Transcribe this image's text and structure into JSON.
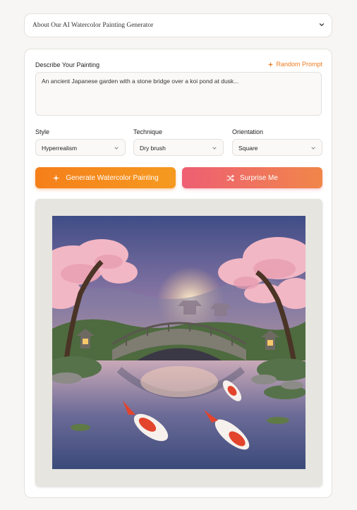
{
  "about": {
    "title": "About Our AI Watercolor Painting Generator",
    "icon": "chevron-down-icon"
  },
  "describe": {
    "label": "Describe Your Painting",
    "random_prompt": "Random Prompt",
    "random_icon": "shuffle-sparkle-icon",
    "placeholder": "An ancient Japanese garden with a stone bridge over a koi pond at dusk..."
  },
  "options": {
    "style": {
      "label": "Style",
      "value": "Hyperrealism"
    },
    "technique": {
      "label": "Technique",
      "value": "Dry brush"
    },
    "orientation": {
      "label": "Orientation",
      "value": "Square"
    }
  },
  "actions": {
    "generate": "Generate Watercolor Painting",
    "generate_icon": "sparkle-icon",
    "surprise": "Surprise Me",
    "surprise_icon": "shuffle-icon"
  },
  "colors": {
    "accent_orange": "#f57f1a",
    "accent_pink": "#ee5f73",
    "link_orange": "#f07b1e"
  }
}
